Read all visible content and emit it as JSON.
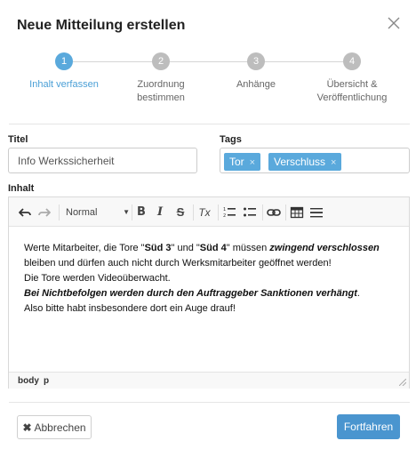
{
  "dialog": {
    "title": "Neue Mitteilung erstellen",
    "close_icon": "close-icon"
  },
  "stepper": {
    "current_step": 1,
    "steps": [
      {
        "number": "1",
        "label": "Inhalt verfassen",
        "active": true
      },
      {
        "number": "2",
        "label": "Zuordnung bestimmen",
        "active": false
      },
      {
        "number": "3",
        "label": "Anhänge",
        "active": false
      },
      {
        "number": "4",
        "label_line1": "Übersicht &",
        "label_line2": "Veröffentlichung",
        "active": false
      }
    ]
  },
  "form": {
    "title_label": "Titel",
    "title_value": "Info Werkssicherheit",
    "tags_label": "Tags",
    "tags": [
      {
        "label": "Tor",
        "remove": "×"
      },
      {
        "label": "Verschluss",
        "remove": "×"
      }
    ],
    "content_label": "Inhalt"
  },
  "editor": {
    "toolbar": {
      "undo_icon": "undo-icon",
      "redo_icon": "redo-icon",
      "format_select": "Normal",
      "format_arrow": "▼",
      "bold": "B",
      "italic": "I",
      "strike": "S",
      "clear_format": "Tx",
      "ordered_list_icon": "ordered-list-icon",
      "bullet_list_icon": "bullet-list-icon",
      "link_icon": "link-icon",
      "table_icon": "table-icon",
      "horizontal_rule_icon": "horizontal-rule-icon"
    },
    "content": {
      "line1_a": "Werte Mitarbeiter, die Tore \"",
      "line1_b": "Süd 3",
      "line1_c": "\" und \"",
      "line1_d": "Süd 4",
      "line1_e": "\" müssen ",
      "line1_f": "zwingend verschlossen",
      "line2": "bleiben und dürfen auch nicht durch Werksmitarbeiter geöffnet werden!",
      "line3": "Die Tore werden Videoüberwacht.",
      "line4_a": "Bei Nichtbefolgen werden durch den Auftraggeber Sanktionen verhängt",
      "line4_b": ".",
      "line5": "Also bitte habt insbesondere dort ein Auge drauf!"
    },
    "statusbar": {
      "path": [
        "body",
        "p"
      ]
    }
  },
  "footer": {
    "cancel_icon": "✖",
    "cancel_label": "Abbrechen",
    "continue_label": "Fortfahren"
  },
  "colors": {
    "accent": "#5aa9dc",
    "primary_button": "#4a95cf",
    "inactive_step": "#bdbdbd"
  }
}
